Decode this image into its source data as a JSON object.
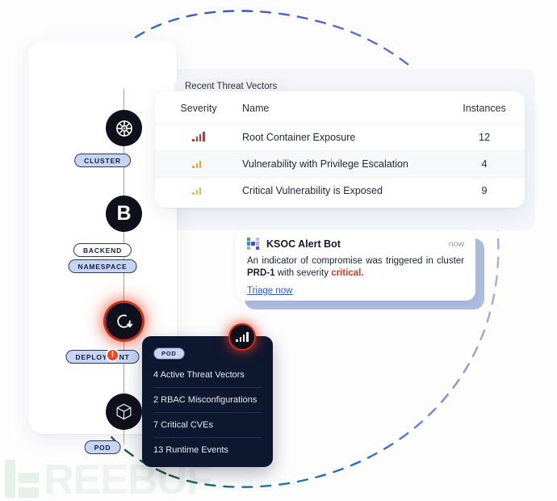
{
  "watermark": {
    "text": "REEBUF",
    "color": "#eef2f0"
  },
  "colors": {
    "accent_blue": "#3258c8",
    "critical_red": "#d3362a",
    "node_dark": "#10101c",
    "card_dark": "#0e1730",
    "pill_blue": "#c7d4f2",
    "glow_red": "#e43e24",
    "sev_high": "#c0392b",
    "sev_med": "#e8a33d"
  },
  "topology": {
    "panel_name": "kubernetes-resource-topology",
    "nodes": [
      {
        "id": "cluster",
        "icon": "kubernetes-helm-icon",
        "glyph": "",
        "label": "CLUSTER",
        "label_style": "blue",
        "alert": false
      },
      {
        "id": "backend",
        "icon": "letter-b-icon",
        "glyph": "B",
        "label": "BACKEND",
        "label_style": "white",
        "alert": false
      },
      {
        "id": "namespace",
        "icon": "",
        "glyph": "",
        "label": "NAMESPACE",
        "label_style": "blue",
        "alert": false
      },
      {
        "id": "deployment",
        "icon": "rotate-arrow-icon",
        "glyph": "",
        "label": "DEPLOYMENT",
        "label_style": "blue",
        "alert": true
      },
      {
        "id": "pod",
        "icon": "cube-icon",
        "glyph": "",
        "label": "POD",
        "label_style": "blue",
        "alert": true
      }
    ],
    "pod_badge": "!"
  },
  "threat_vectors": {
    "tab_label": "Recent Threat Vectors",
    "columns": [
      "Severity",
      "Name",
      "Instances"
    ],
    "rows": [
      {
        "severity_level": 4,
        "severity_color": "#c0392b",
        "name": "Root Container Exposure",
        "instances": "12"
      },
      {
        "severity_level": 3,
        "severity_color": "#e8a33d",
        "name": "Vulnerability with Privilege Escalation",
        "instances": "4"
      },
      {
        "severity_level": 3,
        "severity_color": "#eab558",
        "name": "Critical Vulnerability is Exposed",
        "instances": "9"
      }
    ]
  },
  "alert": {
    "logo_name": "ksoc-logo-icon",
    "logo_tiles": [
      "#3fae4a",
      "#ffffff",
      "#c3b6f2",
      "#2d8fd6",
      "#4a4ad8",
      "#b3a7ef",
      "#7fb7e8",
      "#ffffff",
      "#6b3fd4"
    ],
    "title": "KSOC Alert Bot",
    "time": "now",
    "body_part1": "An indicator of compromise was triggered in cluster ",
    "body_cluster": "PRD-1",
    "body_part2": " with severity ",
    "body_severity": "critical.",
    "link_label": "Triage now"
  },
  "pod_card": {
    "badge_icon": "signal-bars-icon",
    "pill_label": "POD",
    "rows": [
      "4 Active Threat Vectors",
      "2 RBAC Misconfigurations",
      "7 Critical CVEs",
      "13 Runtime Events"
    ]
  }
}
